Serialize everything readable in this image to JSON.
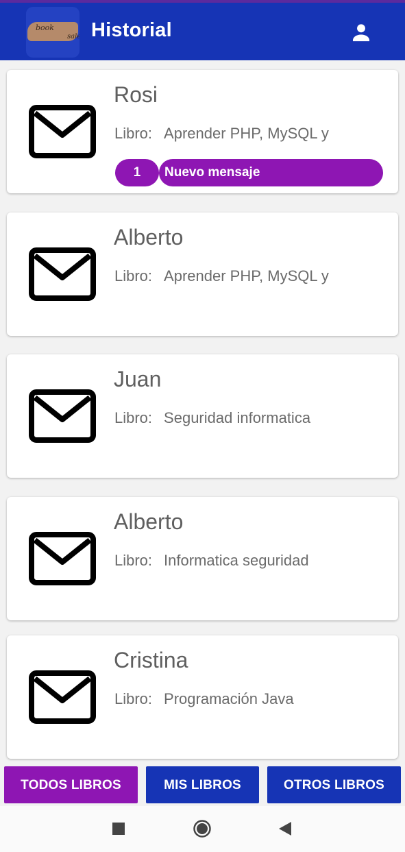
{
  "appbar": {
    "title": "Historial",
    "logo_text_1": "book",
    "logo_text_2": "sale",
    "user_icon": "person-icon",
    "background_color": "#1634b5"
  },
  "conversations": [
    {
      "name": "Rosi",
      "book_label": "Libro:",
      "book_title": "Aprender PHP, MySQL y",
      "unread_count": "1",
      "unread_text": "Nuevo mensaje"
    },
    {
      "name": "Alberto",
      "book_label": "Libro:",
      "book_title": "Aprender PHP, MySQL y"
    },
    {
      "name": "Juan",
      "book_label": "Libro:",
      "book_title": "Seguridad informatica"
    },
    {
      "name": "Alberto",
      "book_label": "Libro:",
      "book_title": "Informatica seguridad"
    },
    {
      "name": "Cristina",
      "book_label": "Libro:",
      "book_title": "Programación Java"
    }
  ],
  "tabs": [
    {
      "label": "TODOS LIBROS",
      "color": "#8e16b3",
      "active": true
    },
    {
      "label": "MIS LIBROS",
      "color": "#1634b5",
      "active": false
    },
    {
      "label": "OTROS LIBROS",
      "color": "#1634b5",
      "active": false
    }
  ],
  "colors": {
    "accent_purple": "#8e16b3",
    "primary_blue": "#1634b5"
  },
  "system_nav": {
    "icons": [
      "recent-apps-icon",
      "home-icon",
      "back-icon"
    ]
  }
}
